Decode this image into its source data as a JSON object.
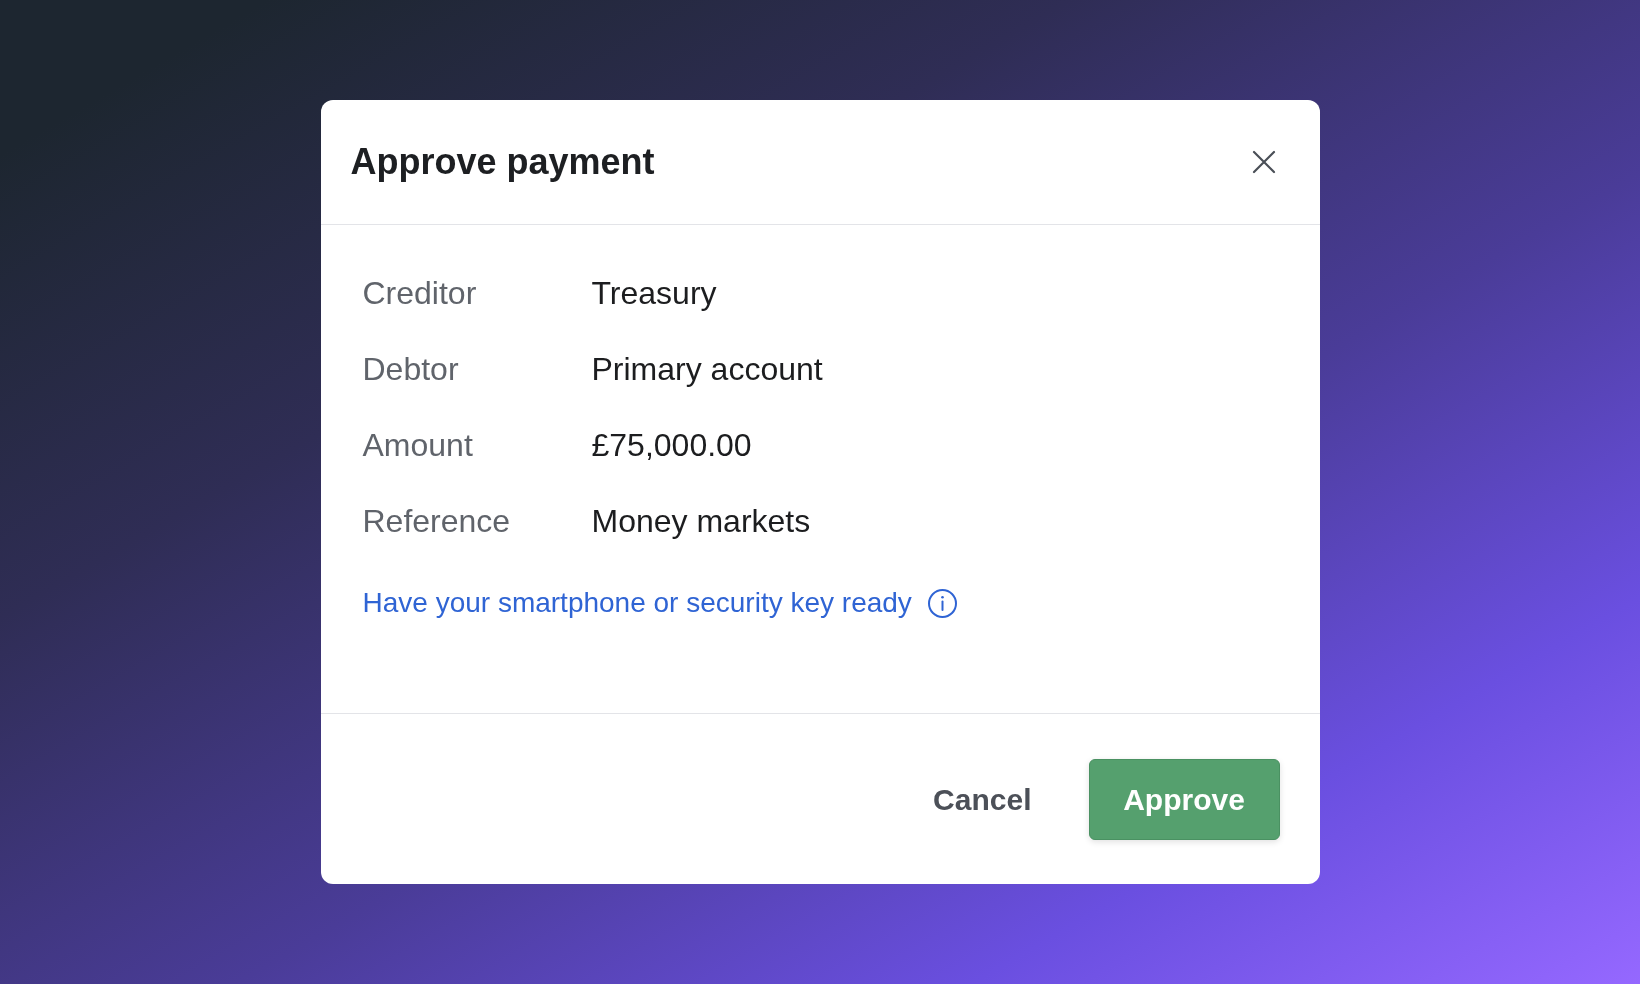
{
  "dialog": {
    "title": "Approve payment"
  },
  "details": [
    {
      "label": "Creditor",
      "value": "Treasury"
    },
    {
      "label": "Debtor",
      "value": "Primary account"
    },
    {
      "label": "Amount",
      "value": "£75,000.00"
    },
    {
      "label": "Reference",
      "value": "Money markets"
    }
  ],
  "hint": {
    "text": "Have your smartphone or security key ready"
  },
  "buttons": [
    {
      "label": "Cancel",
      "kind": "secondary"
    },
    {
      "label": "Approve",
      "kind": "primary"
    }
  ]
}
